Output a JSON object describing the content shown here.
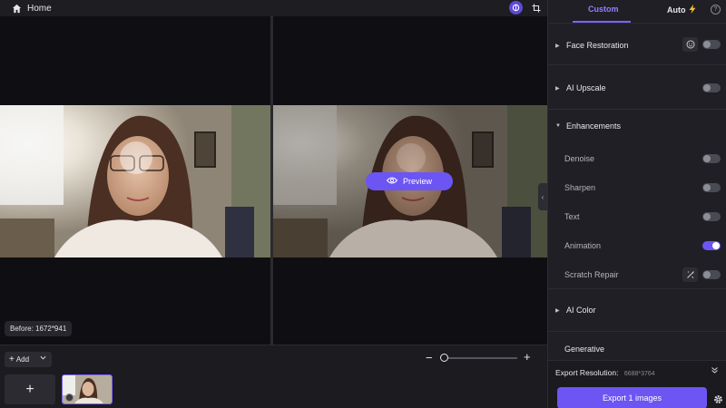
{
  "topbar": {
    "home_label": "Home",
    "icons": [
      "home-icon",
      "compare-icon",
      "crop-icon"
    ]
  },
  "canvas": {
    "before_label": "Before: 1672*941",
    "preview_label": "Preview"
  },
  "bottom": {
    "add_label": "Add",
    "add_tile": "+",
    "zoom_minus": "−",
    "zoom_plus": "+"
  },
  "panel": {
    "tabs": {
      "custom": "Custom",
      "auto": "Auto"
    },
    "sections": {
      "face_restoration": "Face Restoration",
      "ai_upscale": "AI Upscale",
      "enhancements": "Enhancements",
      "ai_color": "AI Color",
      "generative": "Generative"
    },
    "enhancement_items": {
      "denoise": "Denoise",
      "sharpen": "Sharpen",
      "text": "Text",
      "animation": "Animation",
      "scratch_repair": "Scratch Repair"
    },
    "toggles": {
      "face_restoration": false,
      "ai_upscale": false,
      "denoise": false,
      "sharpen": false,
      "text": false,
      "animation": true,
      "scratch_repair": false
    },
    "export": {
      "resolution_label": "Export Resolution:",
      "resolution_value": "6688*3764",
      "button_label": "Export 1 images"
    }
  },
  "colors": {
    "accent": "#6c55f3",
    "accent_light": "#9180ff",
    "panel_bg": "#1f1f25",
    "canvas_bg": "#0f0f13"
  }
}
